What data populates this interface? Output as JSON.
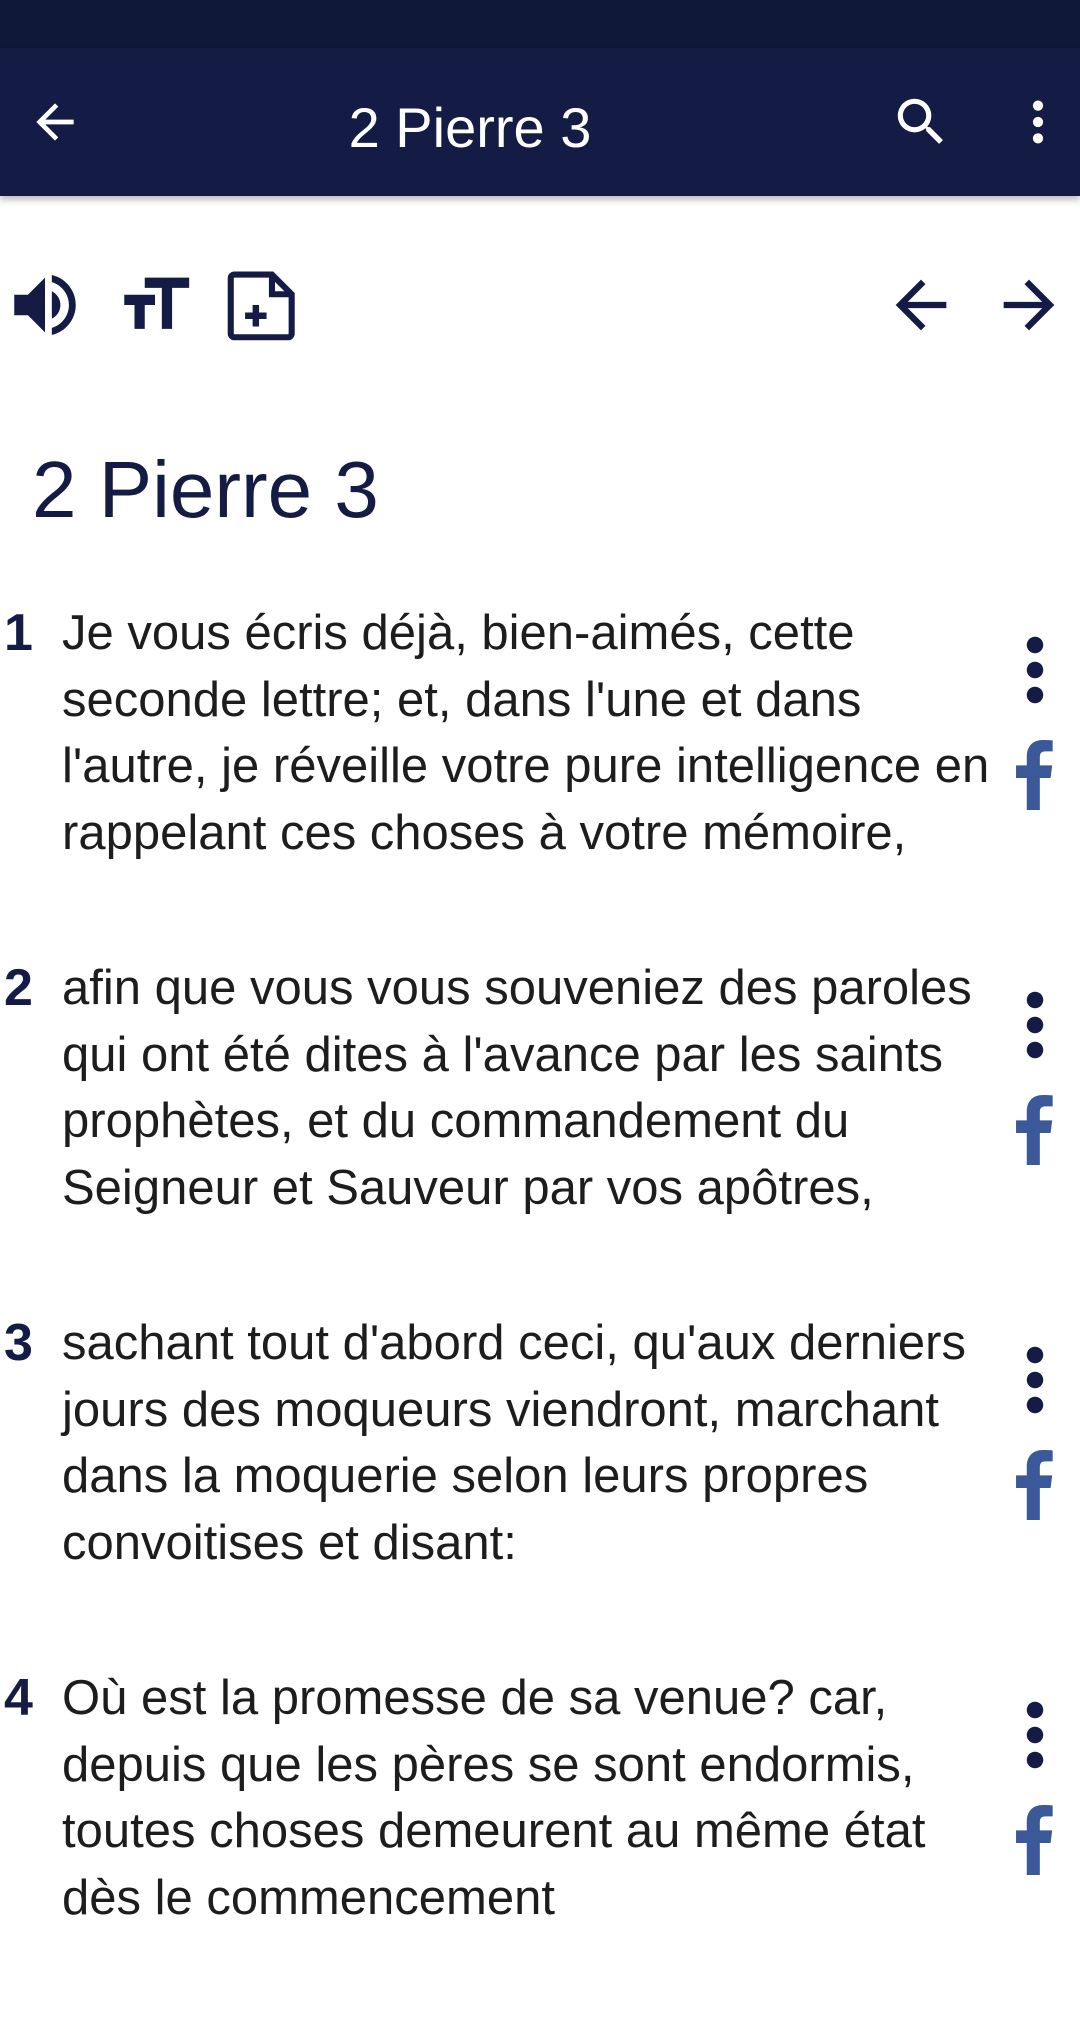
{
  "app_bar": {
    "title": "2 Pierre 3",
    "back_icon": "arrow-left-icon",
    "search_icon": "search-icon",
    "more_icon": "more-vertical-icon"
  },
  "toolbar": {
    "audio_icon": "speaker-icon",
    "text_size_icon": "text-size-icon",
    "add_note_icon": "add-note-icon",
    "prev_icon": "arrow-left-icon",
    "next_icon": "arrow-right-icon"
  },
  "chapter": {
    "title": "2 Pierre 3"
  },
  "verses": [
    {
      "number": "1",
      "text": "Je vous écris déjà, bien-aimés, cette seconde lettre; et, dans l'une et dans l'autre, je réveille votre pure intelligence en rappelant ces choses à votre mémoire,"
    },
    {
      "number": "2",
      "text": "afin que vous vous souveniez des paroles qui ont été dites à l'avance par les saints prophètes, et du commandement du Seigneur et Sauveur par vos apôtres,"
    },
    {
      "number": "3",
      "text": "sachant tout d'abord ceci, qu'aux derniers jours des moqueurs viendront, marchant dans la moquerie selon leurs propres convoitises et disant:"
    },
    {
      "number": "4",
      "text": "Où est la promesse de sa venue? car, depuis que les pères se sont endormis, toutes choses demeurent au même état dès le commencement"
    }
  ],
  "colors": {
    "status_bar": "#0f1838",
    "app_bar": "#141c45",
    "accent": "#141c45",
    "facebook": "#3b5998"
  }
}
